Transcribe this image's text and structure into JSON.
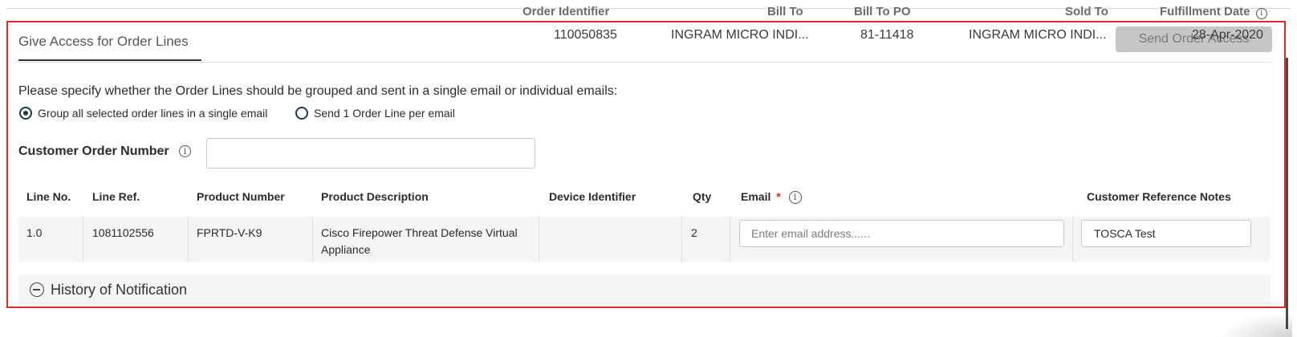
{
  "summary": {
    "headers": {
      "order_identifier": "Order Identifier",
      "bill_to": "Bill To",
      "bill_to_po": "Bill To PO",
      "sold_to": "Sold To",
      "fulfillment_date": "Fulfillment Date"
    },
    "values": {
      "order_identifier": "110050835",
      "bill_to": "INGRAM MICRO INDI...",
      "bill_to_po": "81-11418",
      "sold_to": "INGRAM MICRO INDI...",
      "fulfillment_date": "28-Apr-2020"
    }
  },
  "panel": {
    "tab_title": "Give Access for Order Lines",
    "send_button": "Send Order Access",
    "instruction": "Please specify whether the Order Lines should be grouped and sent in a single email or individual emails:",
    "radio_options": [
      {
        "label": "Group all selected order lines in a single email",
        "selected": true
      },
      {
        "label": "Send 1 Order Line per email",
        "selected": false
      }
    ],
    "customer_order_number_label": "Customer Order Number",
    "customer_order_number_value": ""
  },
  "table": {
    "columns": [
      "Line No.",
      "Line Ref.",
      "Product Number",
      "Product Description",
      "Device Identifier",
      "Qty",
      "Email",
      "Customer Reference Notes"
    ],
    "email_required_mark": "*",
    "rows": [
      {
        "line_no": "1.0",
        "line_ref": "1081102556",
        "product_number": "FPRTD-V-K9",
        "product_description": "Cisco Firepower Threat Defense Virtual Appliance",
        "device_identifier": "",
        "qty": "2",
        "email_placeholder": "Enter email address......",
        "email_value": "",
        "notes": "TOSCA Test"
      }
    ]
  },
  "history": {
    "label": "History of Notification"
  },
  "icons": {
    "info": "info-icon",
    "collapse": "minus-circle-icon"
  },
  "colors": {
    "highlight_border": "#e02b2b",
    "button_bg": "#c6c6c6",
    "required": "#e02b2b"
  }
}
